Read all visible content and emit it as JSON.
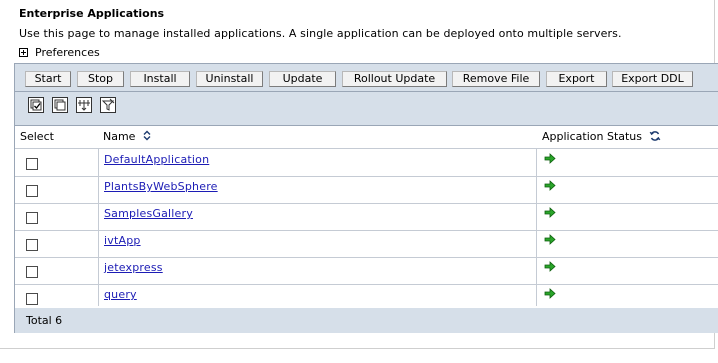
{
  "page": {
    "title": "Enterprise Applications",
    "description": "Use this page to manage installed applications. A single application can be deployed onto multiple servers.",
    "preferences_label": "Preferences"
  },
  "toolbar": {
    "buttons": [
      {
        "label": "Start"
      },
      {
        "label": "Stop"
      },
      {
        "label": "Install"
      },
      {
        "label": "Uninstall"
      },
      {
        "label": "Update"
      },
      {
        "label": "Rollout Update"
      },
      {
        "label": "Remove File"
      },
      {
        "label": "Export"
      },
      {
        "label": "Export DDL"
      }
    ],
    "icons": [
      "select-all-icon",
      "deselect-all-icon",
      "show-filter-icon",
      "clear-filter-icon"
    ]
  },
  "table": {
    "columns": {
      "select": "Select",
      "name": "Name",
      "status": "Application Status"
    },
    "rows": [
      {
        "name": "DefaultApplication",
        "status_icon": "started-arrow-icon"
      },
      {
        "name": "PlantsByWebSphere",
        "status_icon": "started-arrow-icon"
      },
      {
        "name": "SamplesGallery",
        "status_icon": "started-arrow-icon"
      },
      {
        "name": "ivtApp",
        "status_icon": "started-arrow-icon"
      },
      {
        "name": "jetexpress",
        "status_icon": "started-arrow-icon"
      },
      {
        "name": "query",
        "status_icon": "started-arrow-icon"
      }
    ],
    "total_label": "Total 6"
  },
  "colors": {
    "bar_bg": "#d6dfe9",
    "link": "#1c1cb5",
    "status_green": "#1a9a1a"
  }
}
